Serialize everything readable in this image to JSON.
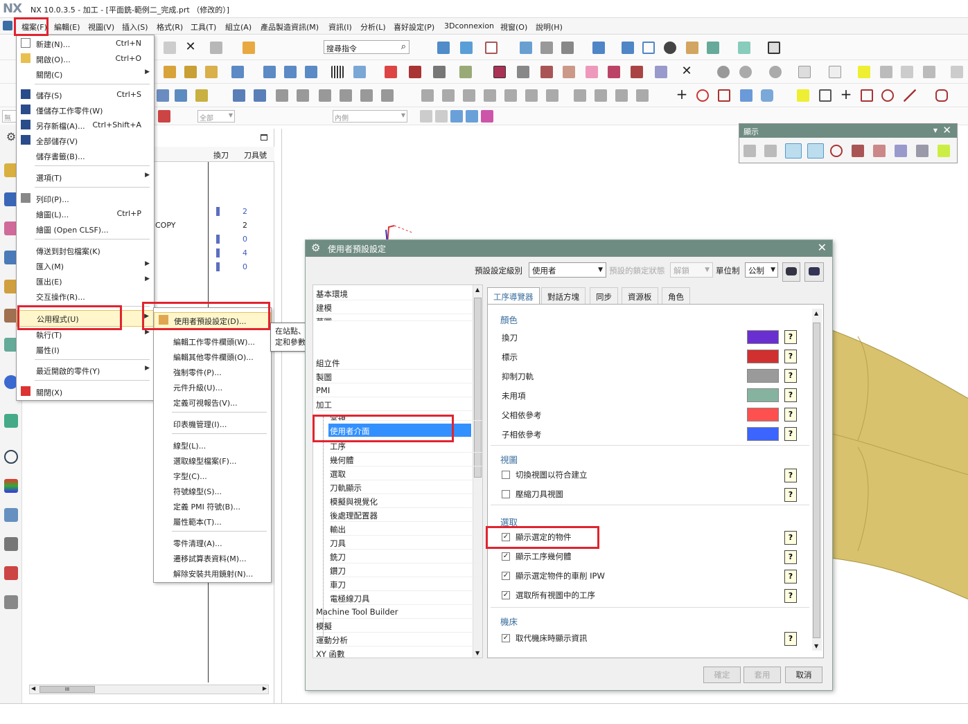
{
  "window": {
    "logo": "NX",
    "title": "NX 10.0.3.5 - 加工 - [平面銑-範例二_完成.prt （修改的）]"
  },
  "menubar": [
    "檔案(F)",
    "編輯(E)",
    "視圖(V)",
    "插入(S)",
    "格式(R)",
    "工具(T)",
    "組立(A)",
    "產品製造資訊(M)",
    "資訊(I)",
    "分析(L)",
    "喜好設定(P)",
    "3Dconnexion",
    "視窗(O)",
    "說明(H)"
  ],
  "toolbar": {
    "search_placeholder": "搜尋指令",
    "filter1": "全部",
    "filter2": "內側",
    "filter0": "無"
  },
  "file_menu": {
    "items": [
      {
        "label": "新建(N)...",
        "shortcut": "Ctrl+N"
      },
      {
        "label": "開啟(O)...",
        "shortcut": "Ctrl+O"
      },
      {
        "label": "關閉(C)",
        "shortcut": ""
      },
      {
        "label": "儲存(S)",
        "shortcut": "Ctrl+S"
      },
      {
        "label": "僅儲存工作零件(W)",
        "shortcut": ""
      },
      {
        "label": "另存新檔(A)...",
        "shortcut": "Ctrl+Shift+A"
      },
      {
        "label": "全部儲存(V)",
        "shortcut": ""
      },
      {
        "label": "儲存書籤(B)...",
        "shortcut": ""
      },
      {
        "label": "選項(T)",
        "shortcut": ""
      },
      {
        "label": "列印(P)...",
        "shortcut": ""
      },
      {
        "label": "繪圖(L)...",
        "shortcut": "Ctrl+P"
      },
      {
        "label": "繪圖 (Open CLSF)...",
        "shortcut": ""
      },
      {
        "label": "傳送到封包檔案(K)",
        "shortcut": ""
      },
      {
        "label": "匯入(M)",
        "shortcut": ""
      },
      {
        "label": "匯出(E)",
        "shortcut": ""
      },
      {
        "label": "交互操作(R)...",
        "shortcut": ""
      },
      {
        "label": "公用程式(U)",
        "shortcut": ""
      },
      {
        "label": "執行(T)",
        "shortcut": ""
      },
      {
        "label": "屬性(I)",
        "shortcut": ""
      },
      {
        "label": "最近開啟的零件(Y)",
        "shortcut": ""
      },
      {
        "label": "關閉(X)",
        "shortcut": ""
      }
    ]
  },
  "utility_menu": {
    "items": [
      "使用者預設設定(D)...",
      "編輯工作零件欄頭(W)...",
      "編輯其他零件欄頭(O)...",
      "強制零件(P)...",
      "元件升級(U)...",
      "定義可視報告(V)...",
      "印表機管理(I)...",
      "線型(L)...",
      "選取線型檔案(F)...",
      "字型(C)...",
      "符號線型(S)...",
      "定義 PMI 符號(B)...",
      "屬性範本(T)...",
      "零件清理(A)...",
      "遷移試算表資料(M)...",
      "解除安裝共用鏡射(N)..."
    ]
  },
  "tooltip": "在站點、群組和使用者級別控制眾多指令和對話方塊的初始設定和參數。",
  "nav": {
    "col_change": "換刀",
    "col_tool": "刀具號",
    "rows": [
      {
        "name": "",
        "tool": "2"
      },
      {
        "name": "COPY",
        "tool": "2"
      },
      {
        "name": "",
        "tool": "0"
      },
      {
        "name": "",
        "tool": "4"
      },
      {
        "name": "",
        "tool": "0"
      }
    ],
    "scroll_mark": "III"
  },
  "display_panel": {
    "title": "顯示"
  },
  "dialog": {
    "title": "使用者預設設定",
    "level_label": "預設設定級別",
    "level_value": "使用者",
    "lock_label": "預設的鎖定狀態",
    "lock_value": "解鎖",
    "unit_label": "單位制",
    "unit_value": "公制",
    "tree": [
      "基本環境",
      "建模",
      "草圖",
      "",
      "",
      "",
      "",
      "組立件",
      "製圖",
      "PMI",
      "加工",
      "常規",
      "使用者介面",
      "工序",
      "幾何體",
      "選取",
      "刀軌顯示",
      "模擬與視覺化",
      "後處理配置器",
      "輸出",
      "刀具",
      "銑刀",
      "鑽刀",
      "車刀",
      "電極線刀具",
      "Machine Tool Builder",
      "模擬",
      "運動分析",
      "XY 函數"
    ],
    "tabs": [
      "工序導覽器",
      "對話方塊",
      "同步",
      "資源板",
      "角色"
    ],
    "sections": {
      "color": {
        "title": "顏色",
        "rows": [
          {
            "label": "換刀",
            "color": "#6a2fd0"
          },
          {
            "label": "標示",
            "color": "#d03030"
          },
          {
            "label": "抑制刀軌",
            "color": "#9a9a9a"
          },
          {
            "label": "未用項",
            "color": "#86b3a0"
          },
          {
            "label": "父相依參考",
            "color": "#ff5050"
          },
          {
            "label": "子相依參考",
            "color": "#3c64ff"
          }
        ]
      },
      "view": {
        "title": "視圖",
        "rows": [
          {
            "label": "切換視圖以符合建立",
            "checked": false
          },
          {
            "label": "壓縮刀具視圖",
            "checked": false
          }
        ]
      },
      "select": {
        "title": "選取",
        "rows": [
          {
            "label": "顯示選定的物件",
            "checked": true
          },
          {
            "label": "顯示工序幾何體",
            "checked": true
          },
          {
            "label": "顯示選定物件的車削 IPW",
            "checked": true
          },
          {
            "label": "選取所有視圖中的工序",
            "checked": true
          }
        ]
      },
      "machine": {
        "title": "機床",
        "rows": [
          {
            "label": "取代機床時顯示資訊",
            "checked": true
          }
        ]
      }
    },
    "help": "?",
    "buttons": {
      "ok": "確定",
      "apply": "套用",
      "cancel": "取消"
    }
  },
  "icons": [
    "gear-icon",
    "close-icon",
    "chevron-down-icon",
    "checkmark-icon",
    "help-icon",
    "search-icon"
  ]
}
